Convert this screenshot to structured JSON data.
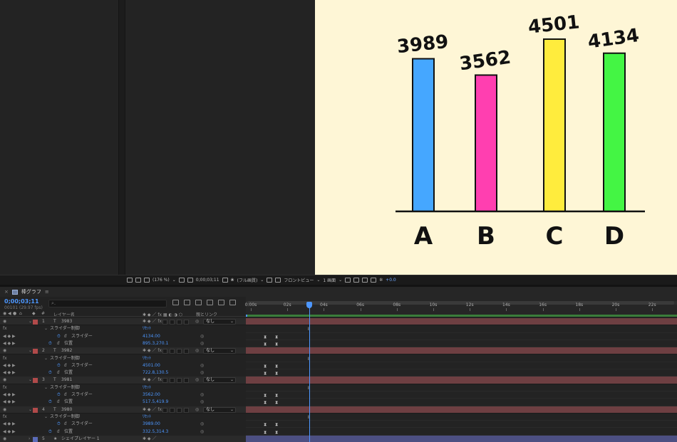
{
  "composition": {
    "tab_title": "棒グラフ",
    "menu_glyph": "≡"
  },
  "chart_data": {
    "type": "bar",
    "categories": [
      "A",
      "B",
      "C",
      "D"
    ],
    "values": [
      3989,
      3562,
      4501,
      4134
    ],
    "value_labels": [
      "3989",
      "3562",
      "4501",
      "4134"
    ],
    "colors": [
      "#45a7ff",
      "#ff3fb0",
      "#ffec3d",
      "#44f544"
    ],
    "title": "",
    "xlabel": "",
    "ylabel": "",
    "legend": false,
    "grid": false
  },
  "viewer_toolbar": {
    "zoom": "(176 %)",
    "timecode": "0;00;03;11",
    "quality": "(フル画質)",
    "view": "フロントビュー",
    "views_count": "1 画面",
    "exposure": "+0.0"
  },
  "timeline": {
    "current_time": "0;00;03;11",
    "frame_info": "00101 (29.97 fps)",
    "search_placeholder": "⌕.",
    "columns": {
      "number": "#",
      "layer_name": "レイヤー名",
      "parent_link": "親とリンク"
    },
    "ruler_labels": [
      "0:00s",
      "02s",
      "04s",
      "06s",
      "08s",
      "10s",
      "12s",
      "14s",
      "16s",
      "18s",
      "20s",
      "22s"
    ],
    "layers": [
      {
        "num": "1",
        "type_icon": "T",
        "name": "3983",
        "label_color": "#b14a4a",
        "parent": "なし",
        "effect": "スライダー制御",
        "slider_label": "スライダー",
        "slider_value": "4134.00",
        "position_label": "位置",
        "position_value": "895.3,270.1",
        "reset": "ﾘｾｯﾄ"
      },
      {
        "num": "2",
        "type_icon": "T",
        "name": "3982",
        "label_color": "#b14a4a",
        "parent": "なし",
        "effect": "スライダー制御",
        "slider_label": "スライダー",
        "slider_value": "4501.00",
        "position_label": "位置",
        "position_value": "722.8,130.5",
        "reset": "ﾘｾｯﾄ"
      },
      {
        "num": "3",
        "type_icon": "T",
        "name": "3981",
        "label_color": "#b14a4a",
        "parent": "なし",
        "effect": "スライダー制御",
        "slider_label": "スライダー",
        "slider_value": "3562.00",
        "position_label": "位置",
        "position_value": "517.5,419.9",
        "reset": "ﾘｾｯﾄ"
      },
      {
        "num": "4",
        "type_icon": "T",
        "name": "3980",
        "label_color": "#b14a4a",
        "parent": "なし",
        "effect": "スライダー制御",
        "slider_label": "スライダー",
        "slider_value": "3989.00",
        "position_label": "位置",
        "position_value": "332.5,314.3",
        "reset": "ﾘｾｯﾄ"
      }
    ],
    "shape_layer": {
      "num": "5",
      "type_icon": "★",
      "name": "シェイプレイヤー 1",
      "label_color": "#5a6bb8"
    }
  }
}
